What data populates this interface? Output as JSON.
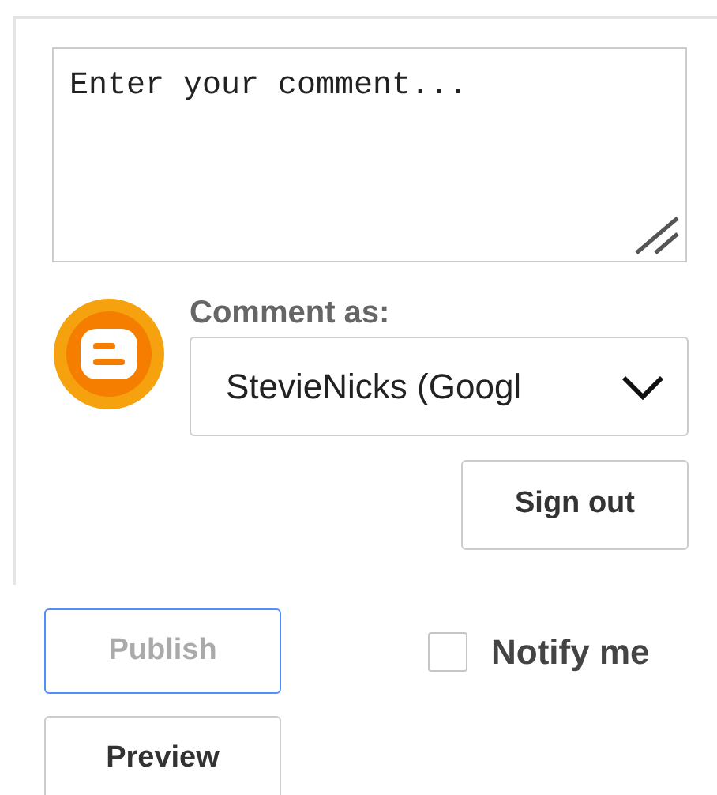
{
  "comment_box": {
    "placeholder": "Enter your comment..."
  },
  "comment_as": {
    "label": "Comment as:",
    "identity": "StevieNicks (Googl",
    "sign_out": "Sign out"
  },
  "publish": {
    "label": "Publish",
    "disabled": true,
    "focused": true
  },
  "notify": {
    "label": "Notify me",
    "checked": false
  },
  "preview": {
    "label": "Preview"
  }
}
